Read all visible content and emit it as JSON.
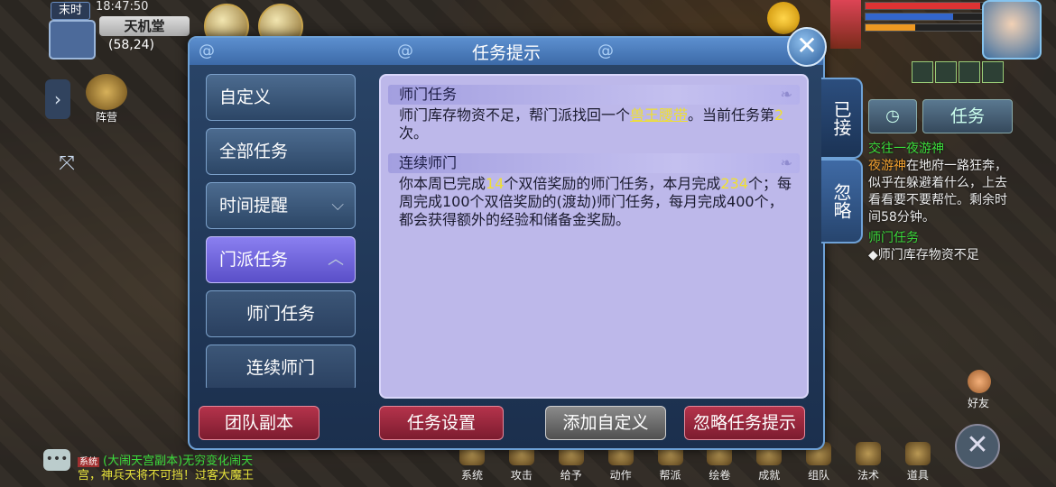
{
  "hud": {
    "mode": "末时",
    "time": "18:47:50",
    "location": "天机堂",
    "coords": "(58,24)",
    "camp_label": "阵营"
  },
  "dialog": {
    "title": "任务提示",
    "categories": [
      {
        "label": "自定义"
      },
      {
        "label": "全部任务"
      },
      {
        "label": "时间提醒",
        "chevron": "chevron-down-icon"
      },
      {
        "label": "门派任务",
        "chevron": "chevron-up-icon",
        "active": true
      },
      {
        "label": "师门任务"
      },
      {
        "label": "连续师门"
      }
    ],
    "sections": [
      {
        "heading": "师门任务",
        "parts": [
          "师门库存物资不足，帮门派找回一个",
          "兽王腰带",
          "。当前任务第",
          "2",
          "次。"
        ]
      },
      {
        "heading": "连续师门",
        "parts": [
          "你本周已完成",
          "14",
          "个双倍奖励的师门任务，本月完成",
          "234",
          "个；每周完成100个双倍奖励的(渡劫)师门任务，每月完成400个，都会获得额外的经验和储备金奖励。"
        ]
      }
    ],
    "buttons": {
      "team_dungeon": "团队副本",
      "task_settings": "任务设置",
      "add_custom": "添加自定义",
      "ignore_tip": "忽略任务提示"
    },
    "side_tabs": {
      "accepted": "已接",
      "ignored": "忽略"
    }
  },
  "tracker": {
    "task_tab": "任务",
    "entry1_title": "交往一夜游神",
    "entry1_npc": "夜游神",
    "entry1_text": "在地府一路狂奔，似乎在躲避着什么，上去看看要不要帮忙。剩余时间58分钟。",
    "entry2_title": "师门任务",
    "entry2_text": "◆师门库存物资不足"
  },
  "chat": {
    "tag": "系统",
    "line1": "(大闹天宫副本)无穷变化闹天",
    "line2": "宫，神兵天将不可挡！过客大魔王"
  },
  "bottom_bar": [
    "系统",
    "攻击",
    "给予",
    "动作",
    "帮派",
    "绘卷",
    "成就",
    "组队",
    "法术",
    "道具"
  ],
  "friends_label": "好友",
  "colors": {
    "dialog_bg": "#1b2f4d",
    "content_bg": "#bdb8ea",
    "active_tab": "#7a6fe6",
    "highlight": "#f0e030",
    "red_button": "#9a2640"
  }
}
